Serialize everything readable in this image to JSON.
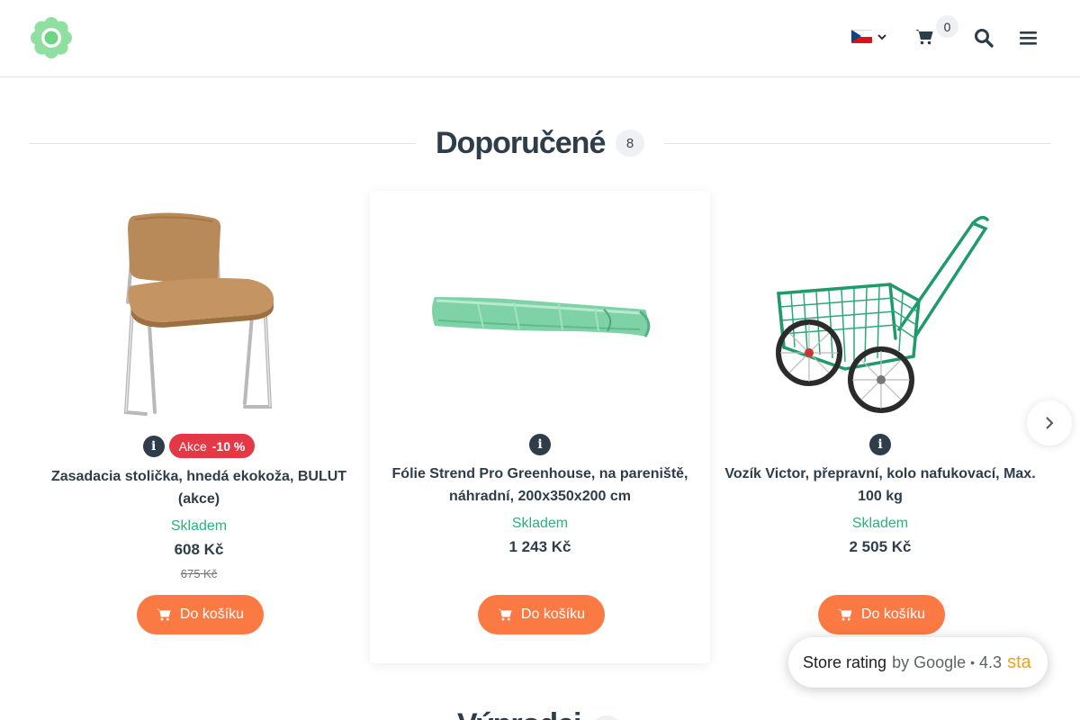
{
  "header": {
    "cart_count": "0",
    "language_icon": "czech-flag-icon"
  },
  "section": {
    "title": "Doporučené",
    "count": "8"
  },
  "products": [
    {
      "name": "Zasadacia stolička, hnedá ekokoža, BULUT (akce)",
      "sale_label": "Akce",
      "sale_discount": "-10 %",
      "stock": "Skladem",
      "price": "608 Kč",
      "old_price": "675 Kč",
      "button": "Do košíku"
    },
    {
      "name": "Fólie Strend Pro Greenhouse, na pareniště, náhradní, 200x350x200 cm",
      "stock": "Skladem",
      "price": "1 243 Kč",
      "button": "Do košíku"
    },
    {
      "name": "Vozík Victor, přepravní, kolo nafukovací, Max. 100 kg",
      "stock": "Skladem",
      "price": "2 505 Kč",
      "button": "Do košíku"
    }
  ],
  "rating": {
    "label": "Store rating",
    "by": "by Google",
    "score": "4.3",
    "stars_text": "sta"
  },
  "next_section": {
    "title": "Výprodej"
  },
  "colors": {
    "accent": "#fb7a44",
    "stock": "#2ab27b",
    "sale": "#e53846",
    "title": "#2e3d49",
    "logo": "#7fd98b"
  }
}
